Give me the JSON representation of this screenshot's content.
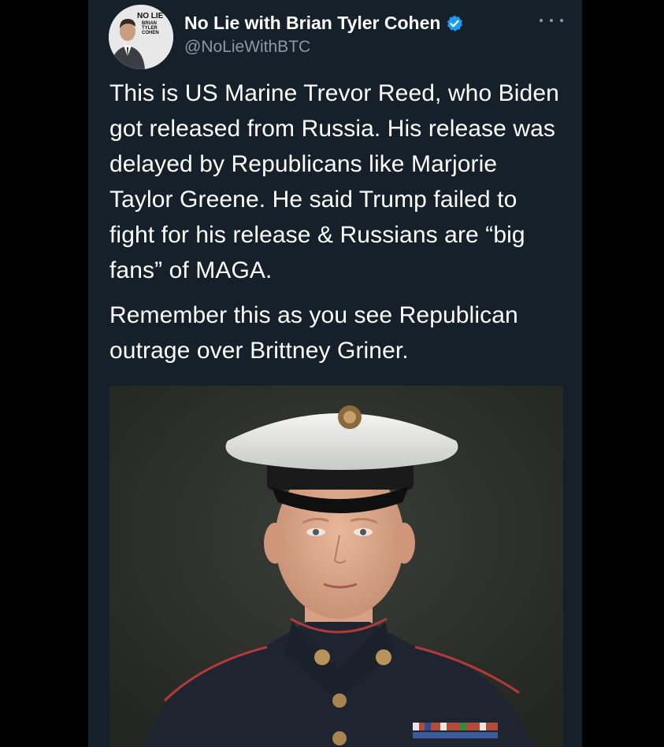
{
  "tweet": {
    "author": {
      "display_name": "No Lie with Brian Tyler Cohen",
      "handle": "@NoLieWithBTC",
      "verified": true,
      "avatar_logo_lines": [
        "NO LIE",
        "BRIAN",
        "TYLER",
        "COHEN"
      ]
    },
    "paragraphs": [
      "This is US Marine Trevor Reed, who Biden got released from Russia. His release was delayed by Republicans like Marjorie Taylor Greene. He said Trump failed to fight for his release & Russians are “big fans” of MAGA.",
      "Remember this as you see Republican outrage over Brittney Griner."
    ],
    "media": {
      "alt": "Portrait photo of a US Marine in dress blue uniform with white cap"
    }
  },
  "colors": {
    "page_background": "#000000",
    "card_background": "#15202b",
    "text_primary": "#ffffff",
    "text_secondary": "#8b98a5",
    "verified_badge": "#1d9bf0"
  },
  "icons": {
    "verified": "verified-badge-icon",
    "more": "more-horizontal-icon"
  }
}
